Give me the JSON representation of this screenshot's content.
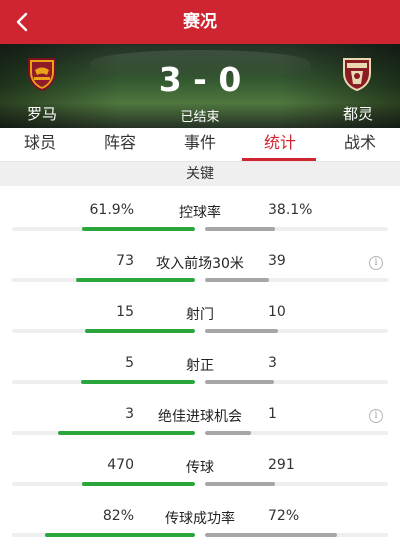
{
  "header": {
    "title": "赛况",
    "back_icon": "chevron-left-icon"
  },
  "match": {
    "home_team": "罗马",
    "away_team": "都灵",
    "score": "3 - 0",
    "status": "已结束"
  },
  "tabs": [
    {
      "label": "球员",
      "active": false
    },
    {
      "label": "阵容",
      "active": false
    },
    {
      "label": "事件",
      "active": false
    },
    {
      "label": "统计",
      "active": true
    },
    {
      "label": "战术",
      "active": false
    }
  ],
  "section": {
    "title": "关键"
  },
  "colors": {
    "accent": "#cf2530",
    "home_bar": "#2aa63c",
    "away_bar": "#a6a6a6"
  },
  "stats": [
    {
      "label": "控球率",
      "home": "61.9%",
      "away": "38.1%",
      "home_ratio": 0.619,
      "away_ratio": 0.381,
      "info": false
    },
    {
      "label": "攻入前场30米",
      "home": "73",
      "away": "39",
      "home_ratio": 0.65,
      "away_ratio": 0.35,
      "info": true
    },
    {
      "label": "射门",
      "home": "15",
      "away": "10",
      "home_ratio": 0.6,
      "away_ratio": 0.4,
      "info": false
    },
    {
      "label": "射正",
      "home": "5",
      "away": "3",
      "home_ratio": 0.625,
      "away_ratio": 0.375,
      "info": false
    },
    {
      "label": "绝佳进球机会",
      "home": "3",
      "away": "1",
      "home_ratio": 0.75,
      "away_ratio": 0.25,
      "info": true
    },
    {
      "label": "传球",
      "home": "470",
      "away": "291",
      "home_ratio": 0.62,
      "away_ratio": 0.38,
      "info": false
    },
    {
      "label": "传球成功率",
      "home": "82%",
      "away": "72%",
      "home_ratio": 0.82,
      "away_ratio": 0.72,
      "info": false
    }
  ]
}
